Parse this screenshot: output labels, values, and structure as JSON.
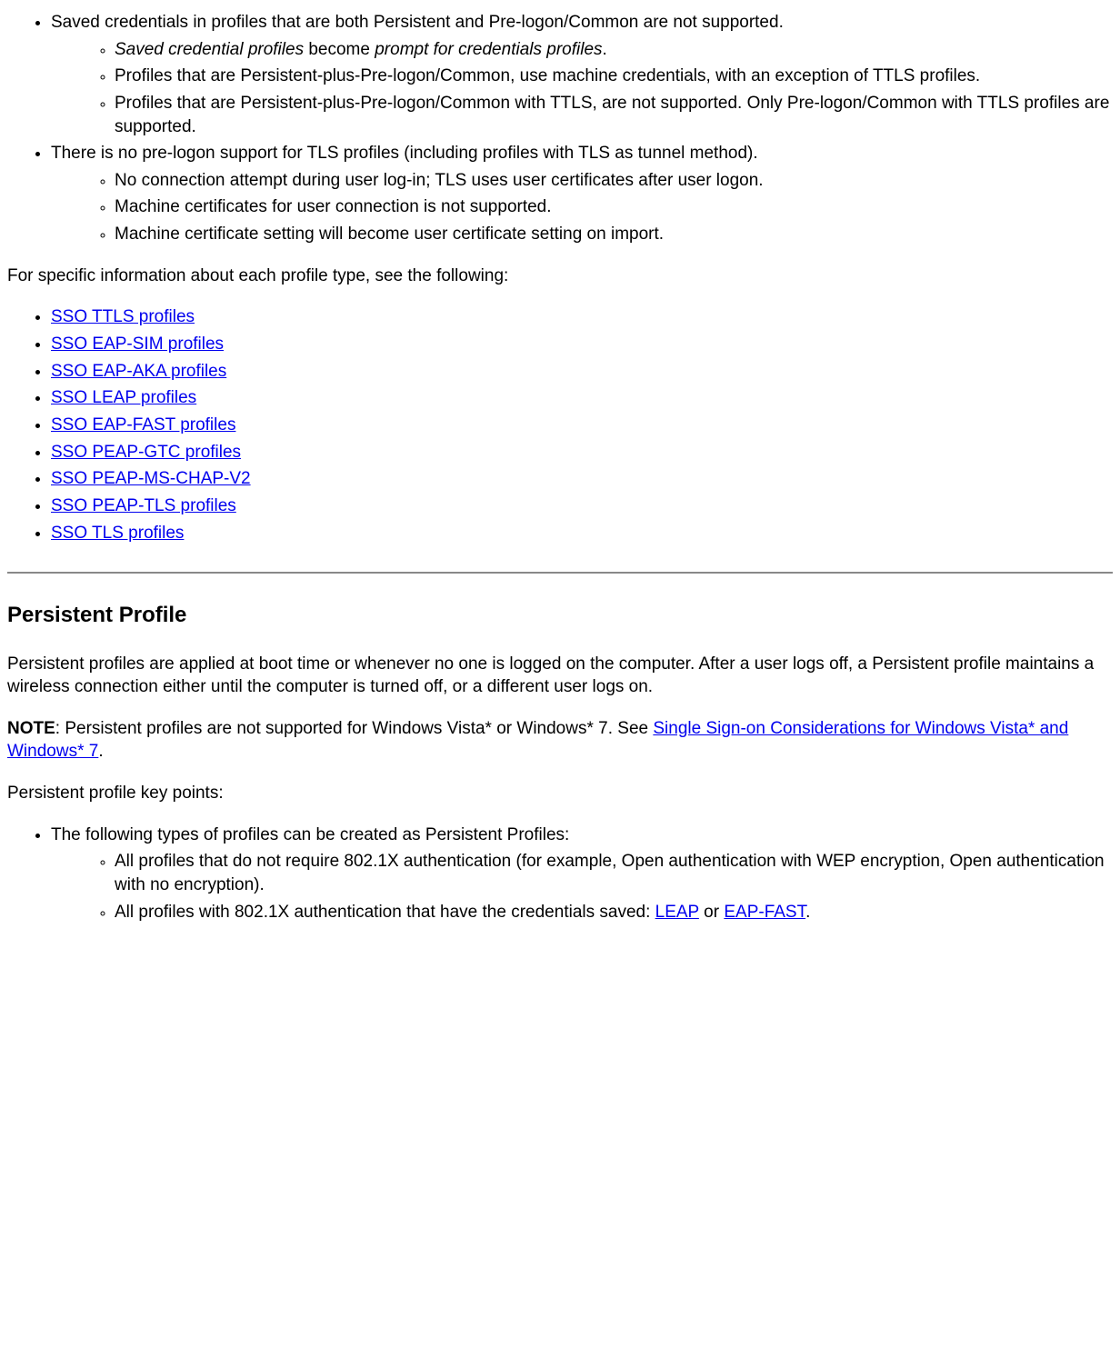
{
  "top_list": {
    "item1": "Saved credentials in profiles that are both Persistent and Pre-logon/Common are not supported.",
    "sub1": {
      "a_italic1": "Saved credential profiles",
      "a_mid": " become ",
      "a_italic2": "prompt for credentials profiles",
      "a_end": ".",
      "b": "Profiles that are Persistent-plus-Pre-logon/Common, use machine credentials, with an exception of TTLS profiles.",
      "c": "Profiles that are Persistent-plus-Pre-logon/Common with TTLS, are not supported. Only Pre-logon/Common with TTLS profiles are supported."
    },
    "item2": "There is no pre-logon support for TLS profiles (including profiles with TLS as tunnel method).",
    "sub2": {
      "a": "No connection attempt during user log-in; TLS uses user certificates after user logon.",
      "b": "Machine certificates for user connection is not supported.",
      "c": "Machine certificate setting will become user certificate setting on import."
    }
  },
  "intro_para": "For specific information about each profile type, see the following:",
  "links": [
    "SSO TTLS profiles",
    "SSO EAP-SIM profiles",
    "SSO EAP-AKA profiles",
    "SSO LEAP profiles",
    "SSO EAP-FAST profiles",
    "SSO PEAP-GTC profiles",
    "SSO PEAP-MS-CHAP-V2",
    "SSO PEAP-TLS profiles",
    "SSO TLS profiles"
  ],
  "heading": "Persistent Profile",
  "persist_para": "Persistent profiles are applied at boot time or whenever no one is logged on the computer. After a user logs off, a Persistent profile maintains a wireless connection either until the computer is turned off, or a different user logs on.",
  "note": {
    "label": "NOTE",
    "text": ": Persistent profiles are not supported for Windows Vista* or Windows* 7. See ",
    "link": "Single Sign-on Considerations for Windows Vista* and Windows* 7",
    "end": "."
  },
  "keypoints_intro": "Persistent profile key points:",
  "keypoints": {
    "item1": "The following types of profiles can be created as Persistent Profiles:",
    "sub": {
      "a": "All profiles that do not require 802.1X authentication (for example, Open authentication with WEP encryption, Open authentication with no encryption).",
      "b_pre": "All profiles with 802.1X authentication that have the credentials saved: ",
      "b_link1": "LEAP",
      "b_mid": " or ",
      "b_link2": "EAP-FAST",
      "b_end": "."
    }
  }
}
